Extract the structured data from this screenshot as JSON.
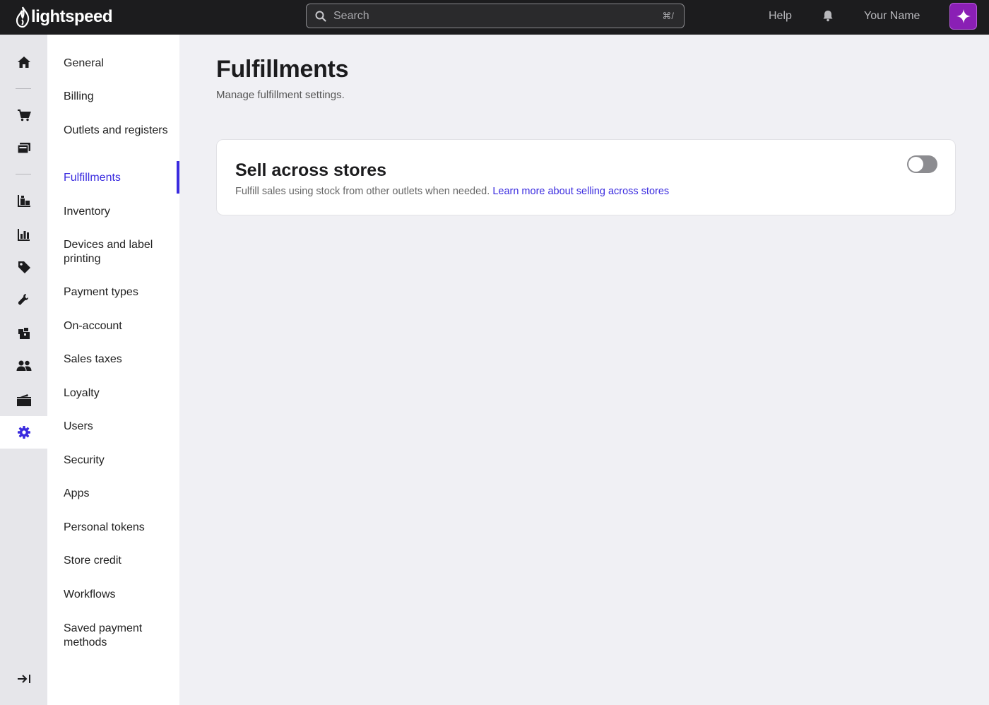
{
  "topbar": {
    "logo_text": "lightspeed",
    "search_placeholder": "Search",
    "search_shortcut": "⌘/",
    "help_label": "Help",
    "user_name": "Your Name"
  },
  "rail": {
    "items": [
      {
        "icon": "home-icon"
      },
      {
        "icon": "cart-icon"
      },
      {
        "icon": "register-icon"
      },
      {
        "icon": "inventory-icon"
      },
      {
        "icon": "reports-icon"
      },
      {
        "icon": "tag-icon"
      },
      {
        "icon": "wrench-icon"
      },
      {
        "icon": "catalog-icon"
      },
      {
        "icon": "customers-icon"
      },
      {
        "icon": "wallet-icon"
      },
      {
        "icon": "settings-icon",
        "active": true
      }
    ],
    "collapse_icon": "collapse-icon"
  },
  "subnav": {
    "items": [
      {
        "label": "General"
      },
      {
        "label": "Billing"
      },
      {
        "label": "Outlets and registers"
      },
      {
        "label": "Fulfillments",
        "active": true
      },
      {
        "label": "Inventory"
      },
      {
        "label": "Devices and label printing"
      },
      {
        "label": "Payment types"
      },
      {
        "label": "On-account"
      },
      {
        "label": "Sales taxes"
      },
      {
        "label": "Loyalty"
      },
      {
        "label": "Users"
      },
      {
        "label": "Security"
      },
      {
        "label": "Apps"
      },
      {
        "label": "Personal tokens"
      },
      {
        "label": "Store credit"
      },
      {
        "label": "Workflows"
      },
      {
        "label": "Saved payment methods"
      }
    ]
  },
  "main": {
    "title": "Fulfillments",
    "subtitle": "Manage fulfillment settings.",
    "card": {
      "title": "Sell across stores",
      "description": "Fulfill sales using stock from other outlets when needed.",
      "link_label": "Learn more about selling across stores",
      "toggle_on": false
    }
  },
  "colors": {
    "accent": "#3a2bdf",
    "topbar_bg": "#1c1c1e",
    "ai_button": "#8a1fb5"
  }
}
